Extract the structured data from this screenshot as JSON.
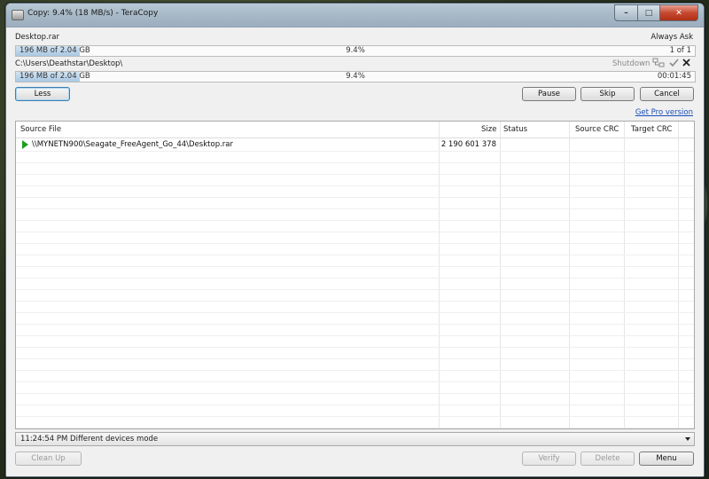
{
  "window": {
    "title": "Copy: 9.4%  (18 MB/s) - TeraCopy",
    "min_glyph": "–",
    "max_glyph": "□",
    "close_glyph": "✕"
  },
  "file_progress": {
    "filename": "Desktop.rar",
    "always_ask": "Always Ask",
    "size_text": "196 MB of 2.04 GB",
    "percent_text": "9.4%",
    "count": "1 of 1",
    "fraction": 0.094
  },
  "total_progress": {
    "path": "C:\\Users\\Deathstar\\Desktop\\",
    "shutdown_label": "Shutdown",
    "size_text": "196 MB of 2.04 GB",
    "percent_text": "9.4%",
    "time_left": "00:01:45",
    "fraction": 0.094
  },
  "buttons": {
    "less": "Less",
    "pause": "Pause",
    "skip": "Skip",
    "cancel": "Cancel",
    "get_pro": "Get Pro version",
    "clean_up": "Clean Up",
    "verify": "Verify",
    "delete": "Delete",
    "menu": "Menu"
  },
  "table": {
    "columns": [
      "Source File",
      "Size",
      "Status",
      "Source CRC",
      "Target CRC"
    ],
    "rows": [
      {
        "source": "\\\\MYNETN900\\Seagate_FreeAgent_Go_44\\Desktop.rar",
        "size": "2 190 601 378",
        "status": "",
        "source_crc": "",
        "target_crc": ""
      }
    ]
  },
  "status_bar": {
    "text": "11:24:54 PM Different devices mode"
  },
  "icons": [
    "teracopy-app-icon",
    "play-icon",
    "network-icon",
    "check-icon",
    "close-x-icon",
    "dropdown-arrow-icon"
  ],
  "colors": {
    "progress_fill": "#a9c8e3",
    "link": "#1a4fb8",
    "play": "#1e9e1e",
    "close_button": "#c6492f"
  }
}
